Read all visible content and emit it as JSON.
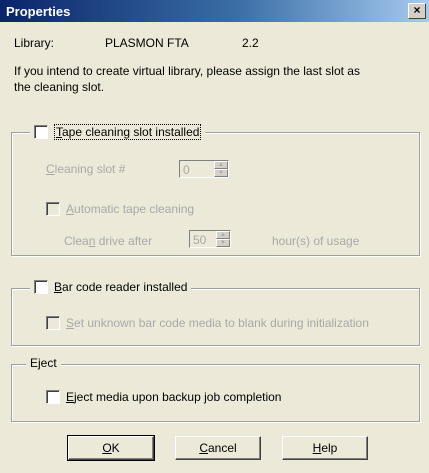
{
  "window": {
    "title": "Properties",
    "close_glyph": "×"
  },
  "library": {
    "label": "Library:",
    "name": "PLASMON FTA",
    "version": "2.2"
  },
  "info_text_line1": "If you intend to create virtual library, please assign the last slot as",
  "info_text_line2": "the cleaning slot.",
  "tape_cleaning": {
    "checkbox_first": "T",
    "checkbox_rest": "ape cleaning slot installed",
    "checked": false,
    "slot_label_first": "C",
    "slot_label_rest": "leaning slot #",
    "slot_value": "0",
    "auto_first": "A",
    "auto_rest": "utomatic tape cleaning",
    "auto_checked": false,
    "clean_after_pre": "Clea",
    "clean_after_key": "n",
    "clean_after_post": " drive after",
    "clean_after_value": "50",
    "hours_label": "hour(s) of usage"
  },
  "bar_code": {
    "checkbox_first": "B",
    "checkbox_rest": "ar code reader installed",
    "checked": false,
    "unknown_first": "S",
    "unknown_rest": "et unknown bar code media to blank during initialization",
    "unknown_checked": false
  },
  "eject": {
    "group_label": "Eject",
    "checkbox_first": "E",
    "checkbox_rest": "ject media upon backup job completion",
    "checked": false
  },
  "buttons": {
    "ok_first": "O",
    "ok_rest": "K",
    "cancel_first": "C",
    "cancel_rest": "ancel",
    "help_first": "H",
    "help_rest": "elp"
  },
  "icons": {
    "close": "close-icon",
    "spin_up": "spin-up-icon",
    "spin_down": "spin-down-icon"
  }
}
